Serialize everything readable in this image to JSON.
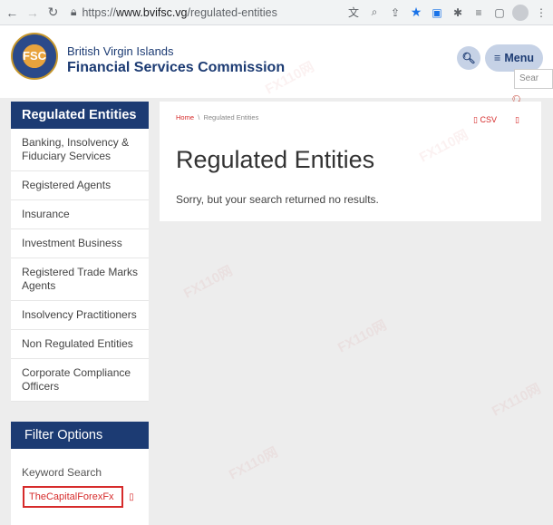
{
  "browser": {
    "url_scheme": "https://",
    "url_host": "www.bvifsc.vg",
    "url_path": "/regulated-entities"
  },
  "header": {
    "brand_line1": "British Virgin Islands",
    "brand_line2": "Financial Services Commission",
    "menu_label": "Menu",
    "search_placeholder": "Sear"
  },
  "sidebar": {
    "title": "Regulated Entities",
    "items": [
      {
        "label": "Banking, Insolvency & Fiduciary Services"
      },
      {
        "label": "Registered Agents"
      },
      {
        "label": "Insurance"
      },
      {
        "label": "Investment Business"
      },
      {
        "label": "Registered Trade Marks Agents"
      },
      {
        "label": "Insolvency Practitioners"
      },
      {
        "label": "Non Regulated Entities"
      },
      {
        "label": "Corporate Compliance Officers"
      }
    ]
  },
  "filter": {
    "title": "Filter Options",
    "keyword_label": "Keyword Search",
    "keyword_value": "TheCapitalForexFx"
  },
  "main": {
    "breadcrumb_home": "Home",
    "breadcrumb_separator": "\\",
    "breadcrumb_current": "Regulated Entities",
    "csv_label": "CSV",
    "page_title": "Regulated Entities",
    "message": "Sorry, but your search returned no results."
  },
  "watermark": {
    "text": "FX110网"
  },
  "colors": {
    "brand_navy": "#1c3b73",
    "accent_red": "#d62b2b",
    "pill_bg": "#c6d2e6",
    "page_bg": "#ededed"
  }
}
